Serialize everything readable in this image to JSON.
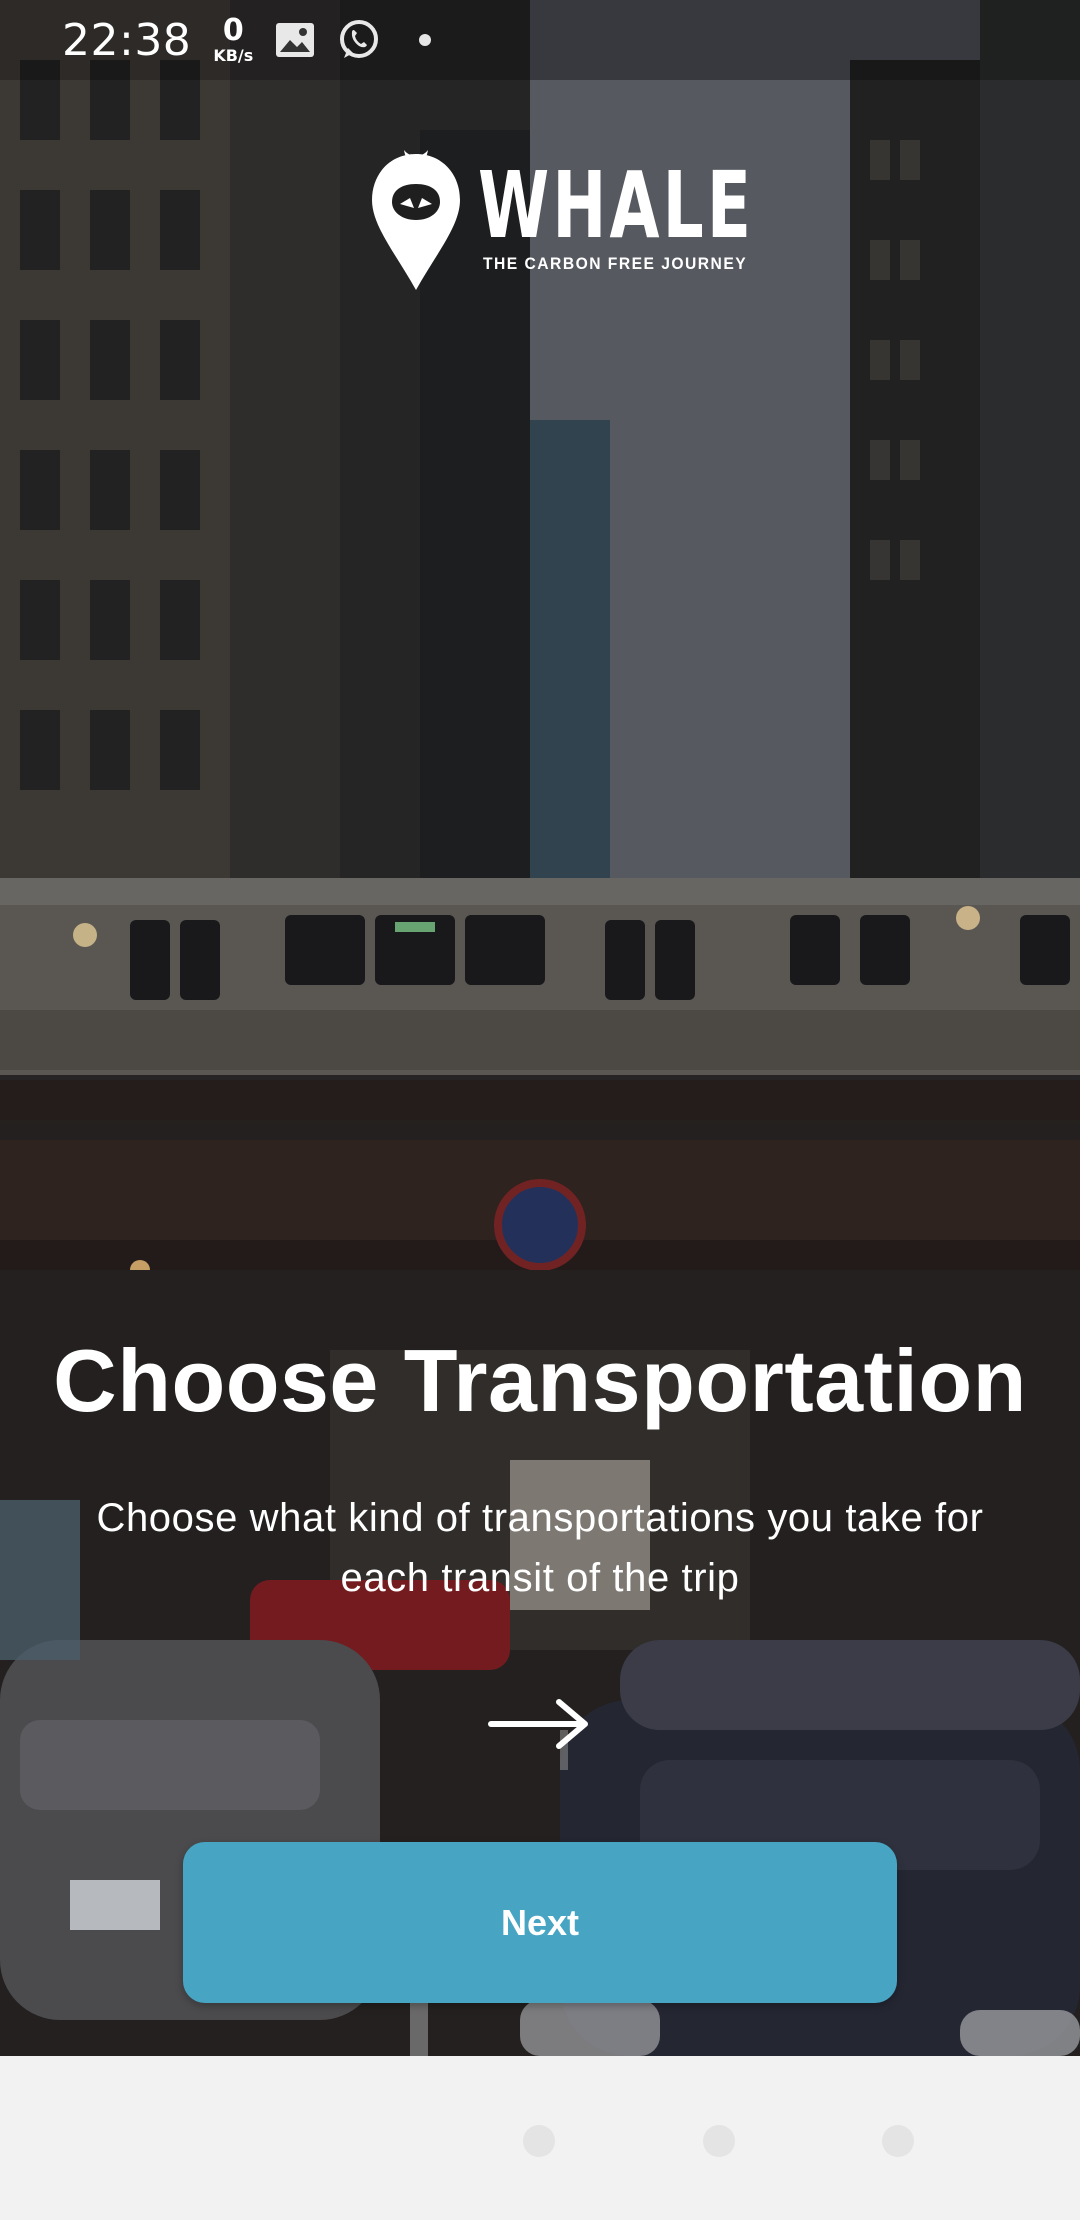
{
  "status_bar": {
    "time": "22:38",
    "speed_value": "0",
    "speed_unit": "KB/s",
    "icons": [
      "gallery-icon",
      "whatsapp-icon",
      "notification-dot"
    ]
  },
  "brand": {
    "name": "WHALE",
    "tagline": "THE CARBON FREE JOURNEY"
  },
  "onboarding": {
    "title": "Choose Transportation",
    "description": "Choose what kind of transportations you take for each transit of the trip",
    "next_arrow_icon": "arrow-right-icon",
    "next_button_label": "Next",
    "page_count": 3
  },
  "colors": {
    "accent": "#47a5c3",
    "text": "#ffffff",
    "bottom_background": "#f2f2f2",
    "page_dot": "#e4e4e4"
  }
}
